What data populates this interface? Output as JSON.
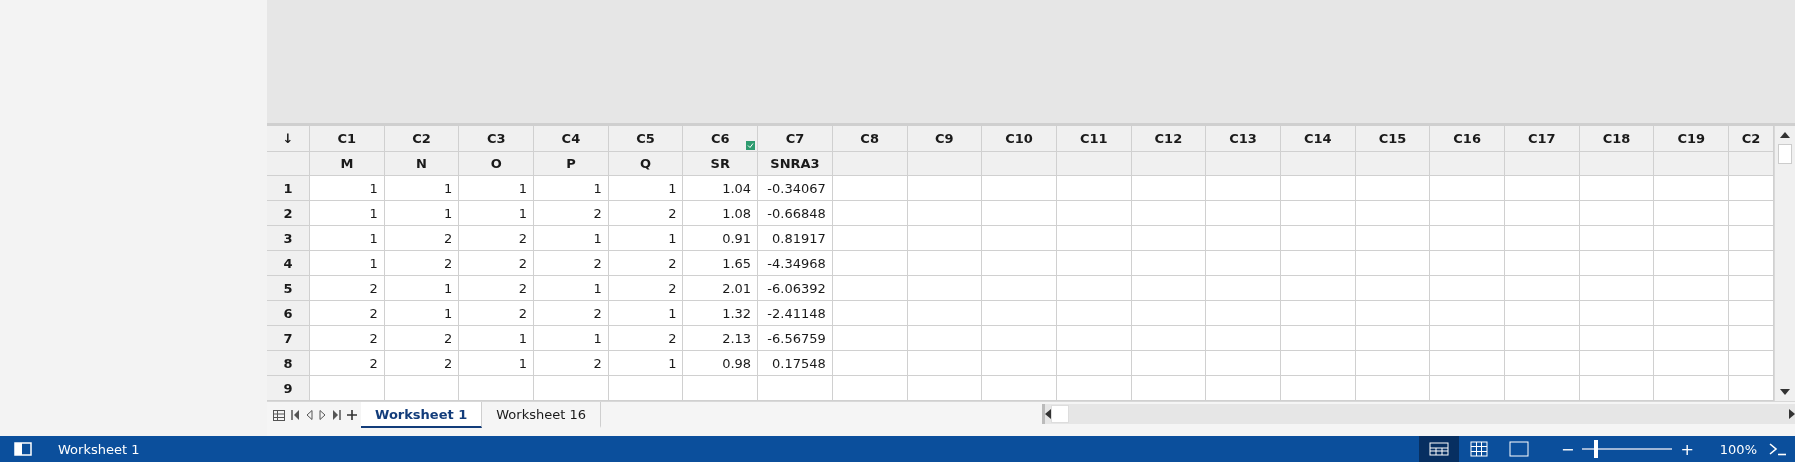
{
  "corner": "↓",
  "columns": [
    {
      "id": "C1",
      "name": "M"
    },
    {
      "id": "C2",
      "name": "N"
    },
    {
      "id": "C3",
      "name": "O"
    },
    {
      "id": "C4",
      "name": "P"
    },
    {
      "id": "C5",
      "name": "Q"
    },
    {
      "id": "C6",
      "name": "SR",
      "marked": true
    },
    {
      "id": "C7",
      "name": "SNRA3"
    },
    {
      "id": "C8"
    },
    {
      "id": "C9"
    },
    {
      "id": "C10"
    },
    {
      "id": "C11"
    },
    {
      "id": "C12"
    },
    {
      "id": "C13"
    },
    {
      "id": "C14"
    },
    {
      "id": "C15"
    },
    {
      "id": "C16"
    },
    {
      "id": "C17"
    },
    {
      "id": "C18"
    },
    {
      "id": "C19"
    },
    {
      "id": "C2",
      "cut": true
    }
  ],
  "rows": [
    {
      "label": "1",
      "cells": [
        "1",
        "1",
        "1",
        "1",
        "1",
        "1.04",
        "-0.34067"
      ]
    },
    {
      "label": "2",
      "cells": [
        "1",
        "1",
        "1",
        "2",
        "2",
        "1.08",
        "-0.66848"
      ]
    },
    {
      "label": "3",
      "cells": [
        "1",
        "2",
        "2",
        "1",
        "1",
        "0.91",
        "0.81917"
      ]
    },
    {
      "label": "4",
      "cells": [
        "1",
        "2",
        "2",
        "2",
        "2",
        "1.65",
        "-4.34968"
      ]
    },
    {
      "label": "5",
      "cells": [
        "2",
        "1",
        "2",
        "1",
        "2",
        "2.01",
        "-6.06392"
      ]
    },
    {
      "label": "6",
      "cells": [
        "2",
        "1",
        "2",
        "2",
        "1",
        "1.32",
        "-2.41148"
      ]
    },
    {
      "label": "7",
      "cells": [
        "2",
        "2",
        "1",
        "1",
        "2",
        "2.13",
        "-6.56759"
      ]
    },
    {
      "label": "8",
      "cells": [
        "2",
        "2",
        "1",
        "2",
        "1",
        "0.98",
        "0.17548"
      ]
    },
    {
      "label": "9",
      "cells": []
    }
  ],
  "sheet_tabs": [
    {
      "label": "Worksheet 1",
      "selected": true
    },
    {
      "label": "Worksheet 16",
      "selected": false
    }
  ],
  "status_bar": {
    "text": "Worksheet 1",
    "views": [
      {
        "kind": "split",
        "selected": true
      },
      {
        "kind": "grid",
        "selected": false
      },
      {
        "kind": "page",
        "selected": false
      }
    ],
    "zoom": {
      "minus": "−",
      "plus": "+",
      "level": 0.13,
      "reading": "100%"
    }
  }
}
